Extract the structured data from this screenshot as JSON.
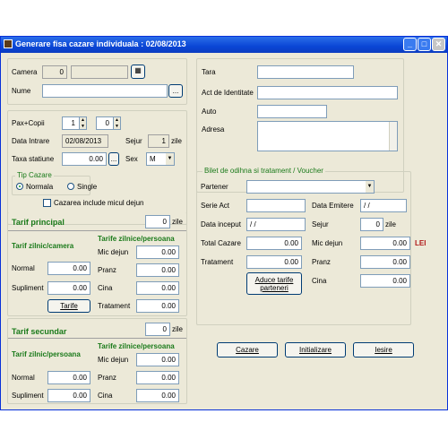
{
  "window": {
    "title": "Generare fisa cazare individuala : 02/08/2013"
  },
  "left": {
    "camera_label": "Camera",
    "camera_number": "0",
    "camera_name": "",
    "nume_label": "Nume",
    "nume_value": "",
    "browse": "...",
    "pax_label": "Pax+Copii",
    "pax_value": "1",
    "copii_value": "0",
    "data_intrare_label": "Data Intrare",
    "data_intrare_value": "02/08/2013",
    "sejur_label": "Sejur",
    "sejur_value": "1",
    "zile": "zile",
    "taxa_label": "Taxa statiune",
    "taxa_value": "0.00",
    "taxa_browse": "...",
    "sex_label": "Sex",
    "sex_value": "M",
    "tip_cazare_label": "Tip Cazare",
    "radio_normala": "Normala",
    "radio_single": "Single",
    "checkbox_label": "Cazarea include micul dejun"
  },
  "tarif_principal": {
    "title": "Tarif principal",
    "zile_value": "0",
    "zile": "zile",
    "camera_header": "Tarif zilnic/camera",
    "persoana_header": "Tarife zilnice/persoana",
    "normal_label": "Normal",
    "normal_value": "0.00",
    "supliment_label": "Supliment",
    "supliment_value": "0.00",
    "mic_dejun_label": "Mic dejun",
    "mic_dejun_value": "0.00",
    "pranz_label": "Pranz",
    "pranz_value": "0.00",
    "cina_label": "Cina",
    "cina_value": "0.00",
    "tratament_label": "Tratament",
    "tratament_value": "0.00",
    "tarife_button": "Tarife"
  },
  "tarif_secundar": {
    "title": "Tarif secundar",
    "zile_value": "0",
    "zile": "zile",
    "persoana_header1": "Tarif zilnic/persoana",
    "persoana_header2": "Tarife zilnice/persoana",
    "normal_label": "Normal",
    "normal_value": "0.00",
    "supliment_label": "Supliment",
    "supliment_value": "0.00",
    "mic_dejun_label": "Mic dejun",
    "mic_dejun_value": "0.00",
    "pranz_label": "Pranz",
    "pranz_value": "0.00",
    "cina_label": "Cina",
    "cina_value": "0.00"
  },
  "right": {
    "tara_label": "Tara",
    "tara_value": "",
    "act_label": "Act de Identitate",
    "act_value": "",
    "auto_label": "Auto",
    "auto_value": "",
    "adresa_label": "Adresa",
    "adresa_value": ""
  },
  "bilet": {
    "title": "Bilet de odihna si tratament / Voucher",
    "partener_label": "Partener",
    "partener_value": "",
    "serie_label": "Serie Act",
    "serie_value": "",
    "data_emitere_label": "Data Emitere",
    "data_emitere_value": " / /",
    "data_inceput_label": "Data inceput",
    "data_inceput_value": " / /",
    "sejur_label": "Sejur",
    "sejur_value": "0",
    "zile": "zile",
    "total_label": "Total Cazare",
    "total_value": "0.00",
    "mic_dejun_label": "Mic dejun",
    "mic_dejun_value": "0.00",
    "currency": "LEI",
    "tratament_label": "Tratament",
    "tratament_value": "0.00",
    "pranz_label": "Pranz",
    "pranz_value": "0.00",
    "cina_label": "Cina",
    "cina_value": "0.00",
    "aduce_button": "Aduce tarife parteneri"
  },
  "actions": {
    "cazare": "Cazare",
    "initializare": "Initializare",
    "iesire": "Iesire"
  }
}
